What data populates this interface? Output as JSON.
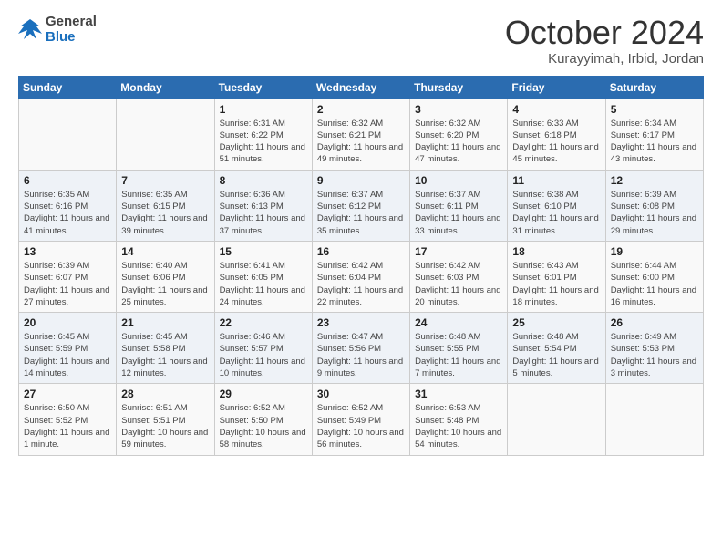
{
  "header": {
    "logo_line1": "General",
    "logo_line2": "Blue",
    "month_title": "October 2024",
    "subtitle": "Kurayyimah, Irbid, Jordan"
  },
  "days_of_week": [
    "Sunday",
    "Monday",
    "Tuesday",
    "Wednesday",
    "Thursday",
    "Friday",
    "Saturday"
  ],
  "weeks": [
    [
      {
        "day": "",
        "info": ""
      },
      {
        "day": "",
        "info": ""
      },
      {
        "day": "1",
        "info": "Sunrise: 6:31 AM\nSunset: 6:22 PM\nDaylight: 11 hours and 51 minutes."
      },
      {
        "day": "2",
        "info": "Sunrise: 6:32 AM\nSunset: 6:21 PM\nDaylight: 11 hours and 49 minutes."
      },
      {
        "day": "3",
        "info": "Sunrise: 6:32 AM\nSunset: 6:20 PM\nDaylight: 11 hours and 47 minutes."
      },
      {
        "day": "4",
        "info": "Sunrise: 6:33 AM\nSunset: 6:18 PM\nDaylight: 11 hours and 45 minutes."
      },
      {
        "day": "5",
        "info": "Sunrise: 6:34 AM\nSunset: 6:17 PM\nDaylight: 11 hours and 43 minutes."
      }
    ],
    [
      {
        "day": "6",
        "info": "Sunrise: 6:35 AM\nSunset: 6:16 PM\nDaylight: 11 hours and 41 minutes."
      },
      {
        "day": "7",
        "info": "Sunrise: 6:35 AM\nSunset: 6:15 PM\nDaylight: 11 hours and 39 minutes."
      },
      {
        "day": "8",
        "info": "Sunrise: 6:36 AM\nSunset: 6:13 PM\nDaylight: 11 hours and 37 minutes."
      },
      {
        "day": "9",
        "info": "Sunrise: 6:37 AM\nSunset: 6:12 PM\nDaylight: 11 hours and 35 minutes."
      },
      {
        "day": "10",
        "info": "Sunrise: 6:37 AM\nSunset: 6:11 PM\nDaylight: 11 hours and 33 minutes."
      },
      {
        "day": "11",
        "info": "Sunrise: 6:38 AM\nSunset: 6:10 PM\nDaylight: 11 hours and 31 minutes."
      },
      {
        "day": "12",
        "info": "Sunrise: 6:39 AM\nSunset: 6:08 PM\nDaylight: 11 hours and 29 minutes."
      }
    ],
    [
      {
        "day": "13",
        "info": "Sunrise: 6:39 AM\nSunset: 6:07 PM\nDaylight: 11 hours and 27 minutes."
      },
      {
        "day": "14",
        "info": "Sunrise: 6:40 AM\nSunset: 6:06 PM\nDaylight: 11 hours and 25 minutes."
      },
      {
        "day": "15",
        "info": "Sunrise: 6:41 AM\nSunset: 6:05 PM\nDaylight: 11 hours and 24 minutes."
      },
      {
        "day": "16",
        "info": "Sunrise: 6:42 AM\nSunset: 6:04 PM\nDaylight: 11 hours and 22 minutes."
      },
      {
        "day": "17",
        "info": "Sunrise: 6:42 AM\nSunset: 6:03 PM\nDaylight: 11 hours and 20 minutes."
      },
      {
        "day": "18",
        "info": "Sunrise: 6:43 AM\nSunset: 6:01 PM\nDaylight: 11 hours and 18 minutes."
      },
      {
        "day": "19",
        "info": "Sunrise: 6:44 AM\nSunset: 6:00 PM\nDaylight: 11 hours and 16 minutes."
      }
    ],
    [
      {
        "day": "20",
        "info": "Sunrise: 6:45 AM\nSunset: 5:59 PM\nDaylight: 11 hours and 14 minutes."
      },
      {
        "day": "21",
        "info": "Sunrise: 6:45 AM\nSunset: 5:58 PM\nDaylight: 11 hours and 12 minutes."
      },
      {
        "day": "22",
        "info": "Sunrise: 6:46 AM\nSunset: 5:57 PM\nDaylight: 11 hours and 10 minutes."
      },
      {
        "day": "23",
        "info": "Sunrise: 6:47 AM\nSunset: 5:56 PM\nDaylight: 11 hours and 9 minutes."
      },
      {
        "day": "24",
        "info": "Sunrise: 6:48 AM\nSunset: 5:55 PM\nDaylight: 11 hours and 7 minutes."
      },
      {
        "day": "25",
        "info": "Sunrise: 6:48 AM\nSunset: 5:54 PM\nDaylight: 11 hours and 5 minutes."
      },
      {
        "day": "26",
        "info": "Sunrise: 6:49 AM\nSunset: 5:53 PM\nDaylight: 11 hours and 3 minutes."
      }
    ],
    [
      {
        "day": "27",
        "info": "Sunrise: 6:50 AM\nSunset: 5:52 PM\nDaylight: 11 hours and 1 minute."
      },
      {
        "day": "28",
        "info": "Sunrise: 6:51 AM\nSunset: 5:51 PM\nDaylight: 10 hours and 59 minutes."
      },
      {
        "day": "29",
        "info": "Sunrise: 6:52 AM\nSunset: 5:50 PM\nDaylight: 10 hours and 58 minutes."
      },
      {
        "day": "30",
        "info": "Sunrise: 6:52 AM\nSunset: 5:49 PM\nDaylight: 10 hours and 56 minutes."
      },
      {
        "day": "31",
        "info": "Sunrise: 6:53 AM\nSunset: 5:48 PM\nDaylight: 10 hours and 54 minutes."
      },
      {
        "day": "",
        "info": ""
      },
      {
        "day": "",
        "info": ""
      }
    ]
  ]
}
